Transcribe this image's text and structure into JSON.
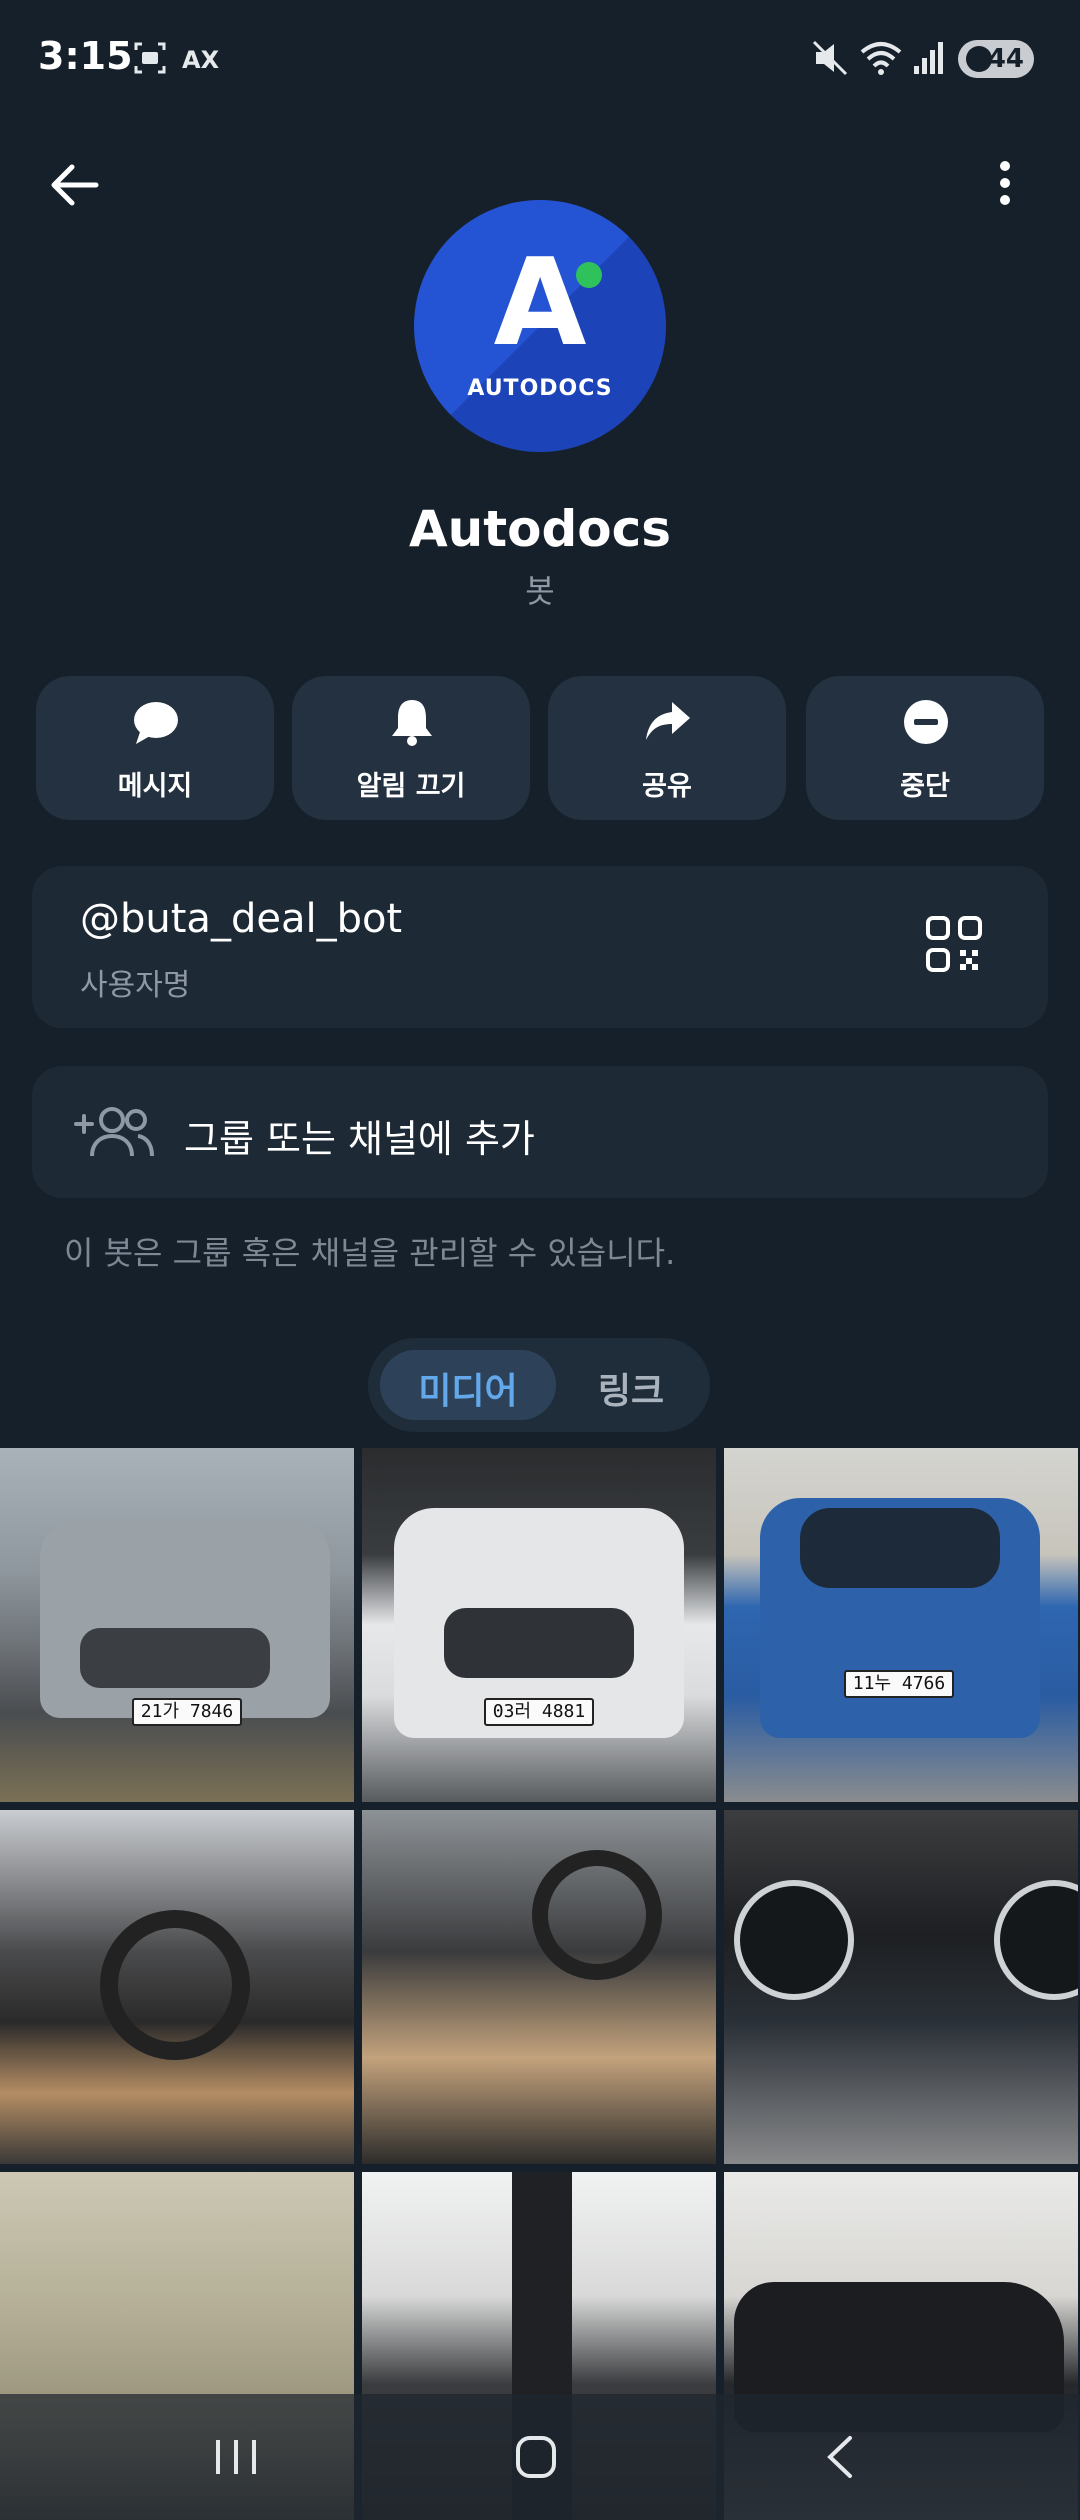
{
  "status_bar": {
    "time": "3:15",
    "ax_label": "AX",
    "battery": "44",
    "icons": [
      "screenshot-icon",
      "mute-icon",
      "wifi-icon",
      "signal-icon",
      "battery-icon"
    ]
  },
  "top_bar": {
    "back_icon": "back-arrow-icon",
    "more_icon": "more-vert-icon"
  },
  "profile": {
    "avatar_letter": "A",
    "avatar_brand": "AUTODOCS",
    "name": "Autodocs",
    "type": "봇"
  },
  "actions": [
    {
      "label": "메시지",
      "icon": "message-icon"
    },
    {
      "label": "알림 끄기",
      "icon": "bell-icon"
    },
    {
      "label": "공유",
      "icon": "share-icon"
    },
    {
      "label": "중단",
      "icon": "stop-icon"
    }
  ],
  "username": {
    "value": "@buta_deal_bot",
    "label": "사용자명",
    "qr_icon": "qr-code-icon"
  },
  "add_to_group": {
    "label": "그룹 또는 채널에 추가",
    "icon": "add-user-icon"
  },
  "hint": "이 봇은 그룹 혹은 채널을 관리할 수 있습니다.",
  "tabs": [
    {
      "label": "미디어",
      "active": true
    },
    {
      "label": "링크",
      "active": false
    }
  ],
  "media": [
    {
      "plate": "21가 7846"
    },
    {
      "plate": "03러 4881"
    },
    {
      "plate": "11누 4766"
    },
    {
      "plate": ""
    },
    {
      "plate": ""
    },
    {
      "plate": ""
    },
    {
      "plate": ""
    },
    {
      "plate": ""
    },
    {
      "plate": ""
    }
  ],
  "nav_bar": {
    "icons": [
      "recent-apps-icon",
      "home-icon",
      "back-icon"
    ]
  },
  "colors": {
    "background": "#16202b",
    "card": "#1d2935",
    "button": "#233140",
    "accent": "#62a8ea",
    "avatar_blue": "#2454d4",
    "online_dot": "#2fc25b"
  }
}
